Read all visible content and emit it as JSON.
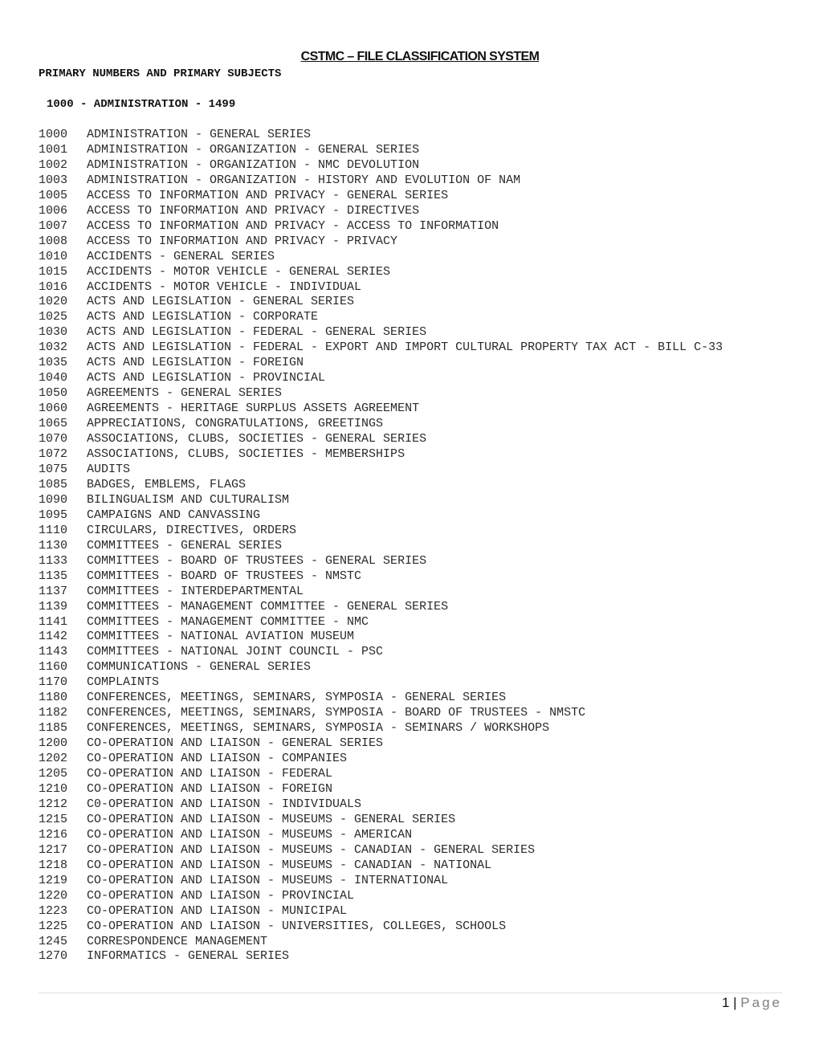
{
  "document": {
    "title": "CSTMC – FILE CLASSIFICATION SYSTEM",
    "subtitle": "PRIMARY NUMBERS AND PRIMARY SUBJECTS",
    "range_heading": "1000 - ADMINISTRATION - 1499"
  },
  "entries": [
    {
      "code": "1000",
      "subject": "ADMINISTRATION - GENERAL SERIES"
    },
    {
      "code": "1001",
      "subject": "ADMINISTRATION - ORGANIZATION - GENERAL SERIES"
    },
    {
      "code": "1002",
      "subject": "ADMINISTRATION - ORGANIZATION - NMC DEVOLUTION"
    },
    {
      "code": "1003",
      "subject": "ADMINISTRATION - ORGANIZATION - HISTORY AND EVOLUTION OF NAM"
    },
    {
      "code": "1005",
      "subject": "ACCESS TO INFORMATION AND PRIVACY - GENERAL SERIES"
    },
    {
      "code": "1006",
      "subject": "ACCESS TO INFORMATION AND PRIVACY - DIRECTIVES"
    },
    {
      "code": "1007",
      "subject": "ACCESS TO INFORMATION AND PRIVACY - ACCESS TO INFORMATION"
    },
    {
      "code": "1008",
      "subject": "ACCESS TO INFORMATION AND PRIVACY - PRIVACY"
    },
    {
      "code": "1010",
      "subject": "ACCIDENTS - GENERAL SERIES"
    },
    {
      "code": "1015",
      "subject": "ACCIDENTS - MOTOR VEHICLE - GENERAL SERIES"
    },
    {
      "code": "1016",
      "subject": "ACCIDENTS - MOTOR VEHICLE - INDIVIDUAL"
    },
    {
      "code": "1020",
      "subject": "ACTS AND LEGISLATION - GENERAL SERIES"
    },
    {
      "code": "1025",
      "subject": "ACTS AND LEGISLATION - CORPORATE"
    },
    {
      "code": "1030",
      "subject": "ACTS AND LEGISLATION - FEDERAL - GENERAL SERIES"
    },
    {
      "code": "1032",
      "subject": "ACTS AND LEGISLATION - FEDERAL - EXPORT AND IMPORT CULTURAL PROPERTY TAX ACT - BILL C-33"
    },
    {
      "code": "1035",
      "subject": "ACTS AND LEGISLATION - FOREIGN"
    },
    {
      "code": "1040",
      "subject": "ACTS AND LEGISLATION - PROVINCIAL"
    },
    {
      "code": "1050",
      "subject": "AGREEMENTS - GENERAL SERIES"
    },
    {
      "code": "1060",
      "subject": "AGREEMENTS - HERITAGE SURPLUS ASSETS AGREEMENT"
    },
    {
      "code": "1065",
      "subject": "APPRECIATIONS, CONGRATULATIONS, GREETINGS"
    },
    {
      "code": "1070",
      "subject": "ASSOCIATIONS, CLUBS, SOCIETIES - GENERAL SERIES"
    },
    {
      "code": "1072",
      "subject": "ASSOCIATIONS, CLUBS, SOCIETIES - MEMBERSHIPS"
    },
    {
      "code": "1075",
      "subject": "AUDITS"
    },
    {
      "code": "1085",
      "subject": "BADGES, EMBLEMS, FLAGS"
    },
    {
      "code": "1090",
      "subject": "BILINGUALISM AND CULTURALISM"
    },
    {
      "code": "1095",
      "subject": "CAMPAIGNS AND CANVASSING"
    },
    {
      "code": "1110",
      "subject": "CIRCULARS, DIRECTIVES, ORDERS"
    },
    {
      "code": "1130",
      "subject": "COMMITTEES - GENERAL SERIES"
    },
    {
      "code": "1133",
      "subject": "COMMITTEES - BOARD OF TRUSTEES - GENERAL SERIES"
    },
    {
      "code": "1135",
      "subject": "COMMITTEES - BOARD OF TRUSTEES - NMSTC"
    },
    {
      "code": "1137",
      "subject": "COMMITTEES - INTERDEPARTMENTAL"
    },
    {
      "code": "1139",
      "subject": "COMMITTEES - MANAGEMENT COMMITTEE - GENERAL SERIES"
    },
    {
      "code": "1141",
      "subject": "COMMITTEES - MANAGEMENT COMMITTEE - NMC"
    },
    {
      "code": "1142",
      "subject": "COMMITTEES - NATIONAL AVIATION MUSEUM"
    },
    {
      "code": "1143",
      "subject": "COMMITTEES - NATIONAL JOINT COUNCIL - PSC"
    },
    {
      "code": "1160",
      "subject": "COMMUNICATIONS - GENERAL SERIES"
    },
    {
      "code": "1170",
      "subject": "COMPLAINTS"
    },
    {
      "code": "1180",
      "subject": "CONFERENCES, MEETINGS, SEMINARS, SYMPOSIA - GENERAL SERIES"
    },
    {
      "code": "1182",
      "subject": "CONFERENCES, MEETINGS, SEMINARS, SYMPOSIA - BOARD OF TRUSTEES - NMSTC"
    },
    {
      "code": "1185",
      "subject": "CONFERENCES, MEETINGS, SEMINARS, SYMPOSIA - SEMINARS / WORKSHOPS"
    },
    {
      "code": "1200",
      "subject": "CO-OPERATION AND LIAISON - GENERAL SERIES"
    },
    {
      "code": "1202",
      "subject": "CO-OPERATION AND LIAISON - COMPANIES"
    },
    {
      "code": "1205",
      "subject": "CO-OPERATION AND LIAISON - FEDERAL"
    },
    {
      "code": "1210",
      "subject": "CO-OPERATION AND LIAISON - FOREIGN"
    },
    {
      "code": "1212",
      "subject": "C0-OPERATION AND LIAISON - INDIVIDUALS"
    },
    {
      "code": "1215",
      "subject": "CO-OPERATION AND LIAISON - MUSEUMS - GENERAL SERIES"
    },
    {
      "code": "1216",
      "subject": "CO-OPERATION AND LIAISON - MUSEUMS - AMERICAN"
    },
    {
      "code": "1217",
      "subject": "CO-OPERATION AND LIAISON - MUSEUMS - CANADIAN - GENERAL SERIES"
    },
    {
      "code": "1218",
      "subject": "CO-OPERATION AND LIAISON - MUSEUMS - CANADIAN - NATIONAL"
    },
    {
      "code": "1219",
      "subject": "CO-OPERATION AND LIAISON - MUSEUMS - INTERNATIONAL"
    },
    {
      "code": "1220",
      "subject": "CO-OPERATION AND LIAISON - PROVINCIAL"
    },
    {
      "code": "1223",
      "subject": "CO-OPERATION AND LIAISON - MUNICIPAL"
    },
    {
      "code": "1225",
      "subject": "CO-OPERATION AND LIAISON - UNIVERSITIES, COLLEGES, SCHOOLS"
    },
    {
      "code": "1245",
      "subject": "CORRESPONDENCE MANAGEMENT"
    },
    {
      "code": "1270",
      "subject": "INFORMATICS - GENERAL SERIES"
    }
  ],
  "footer": {
    "page_number": "1",
    "separator": "|",
    "page_label": "Page"
  }
}
